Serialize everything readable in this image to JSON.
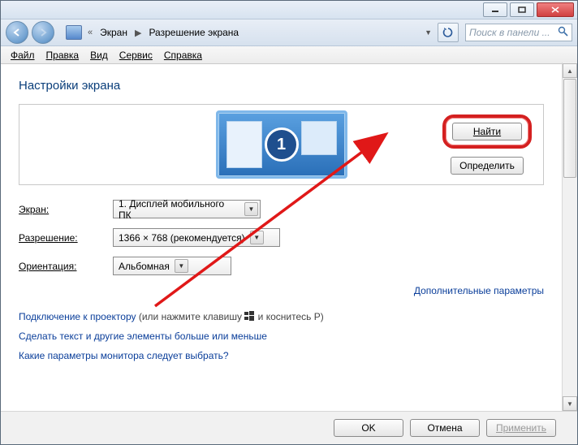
{
  "titlebar": {},
  "nav": {
    "crumb1": "Экран",
    "crumb2": "Разрешение экрана",
    "search_placeholder": "Поиск в панели ..."
  },
  "menu": {
    "file": "Файл",
    "edit": "Правка",
    "view": "Вид",
    "service": "Сервис",
    "help": "Справка"
  },
  "page": {
    "title": "Настройки экрана",
    "monitor_number": "1",
    "find_btn": "Найти",
    "detect_btn": "Определить"
  },
  "form": {
    "display_label": "Экран:",
    "display_value": "1. Дисплей мобильного ПК",
    "resolution_label": "Разрешение:",
    "resolution_value": "1366 × 768 (рекомендуется)",
    "orientation_label": "Ориентация:",
    "orientation_value": "Альбомная"
  },
  "links": {
    "advanced": "Дополнительные параметры",
    "projector_a": "Подключение к проектору",
    "projector_b": " (или нажмите клавишу ",
    "projector_c": " и коснитесь P)",
    "textsize": "Сделать текст и другие элементы больше или меньше",
    "monitorparams": "Какие параметры монитора следует выбрать?"
  },
  "footer": {
    "ok": "OK",
    "cancel": "Отмена",
    "apply": "Применить"
  }
}
